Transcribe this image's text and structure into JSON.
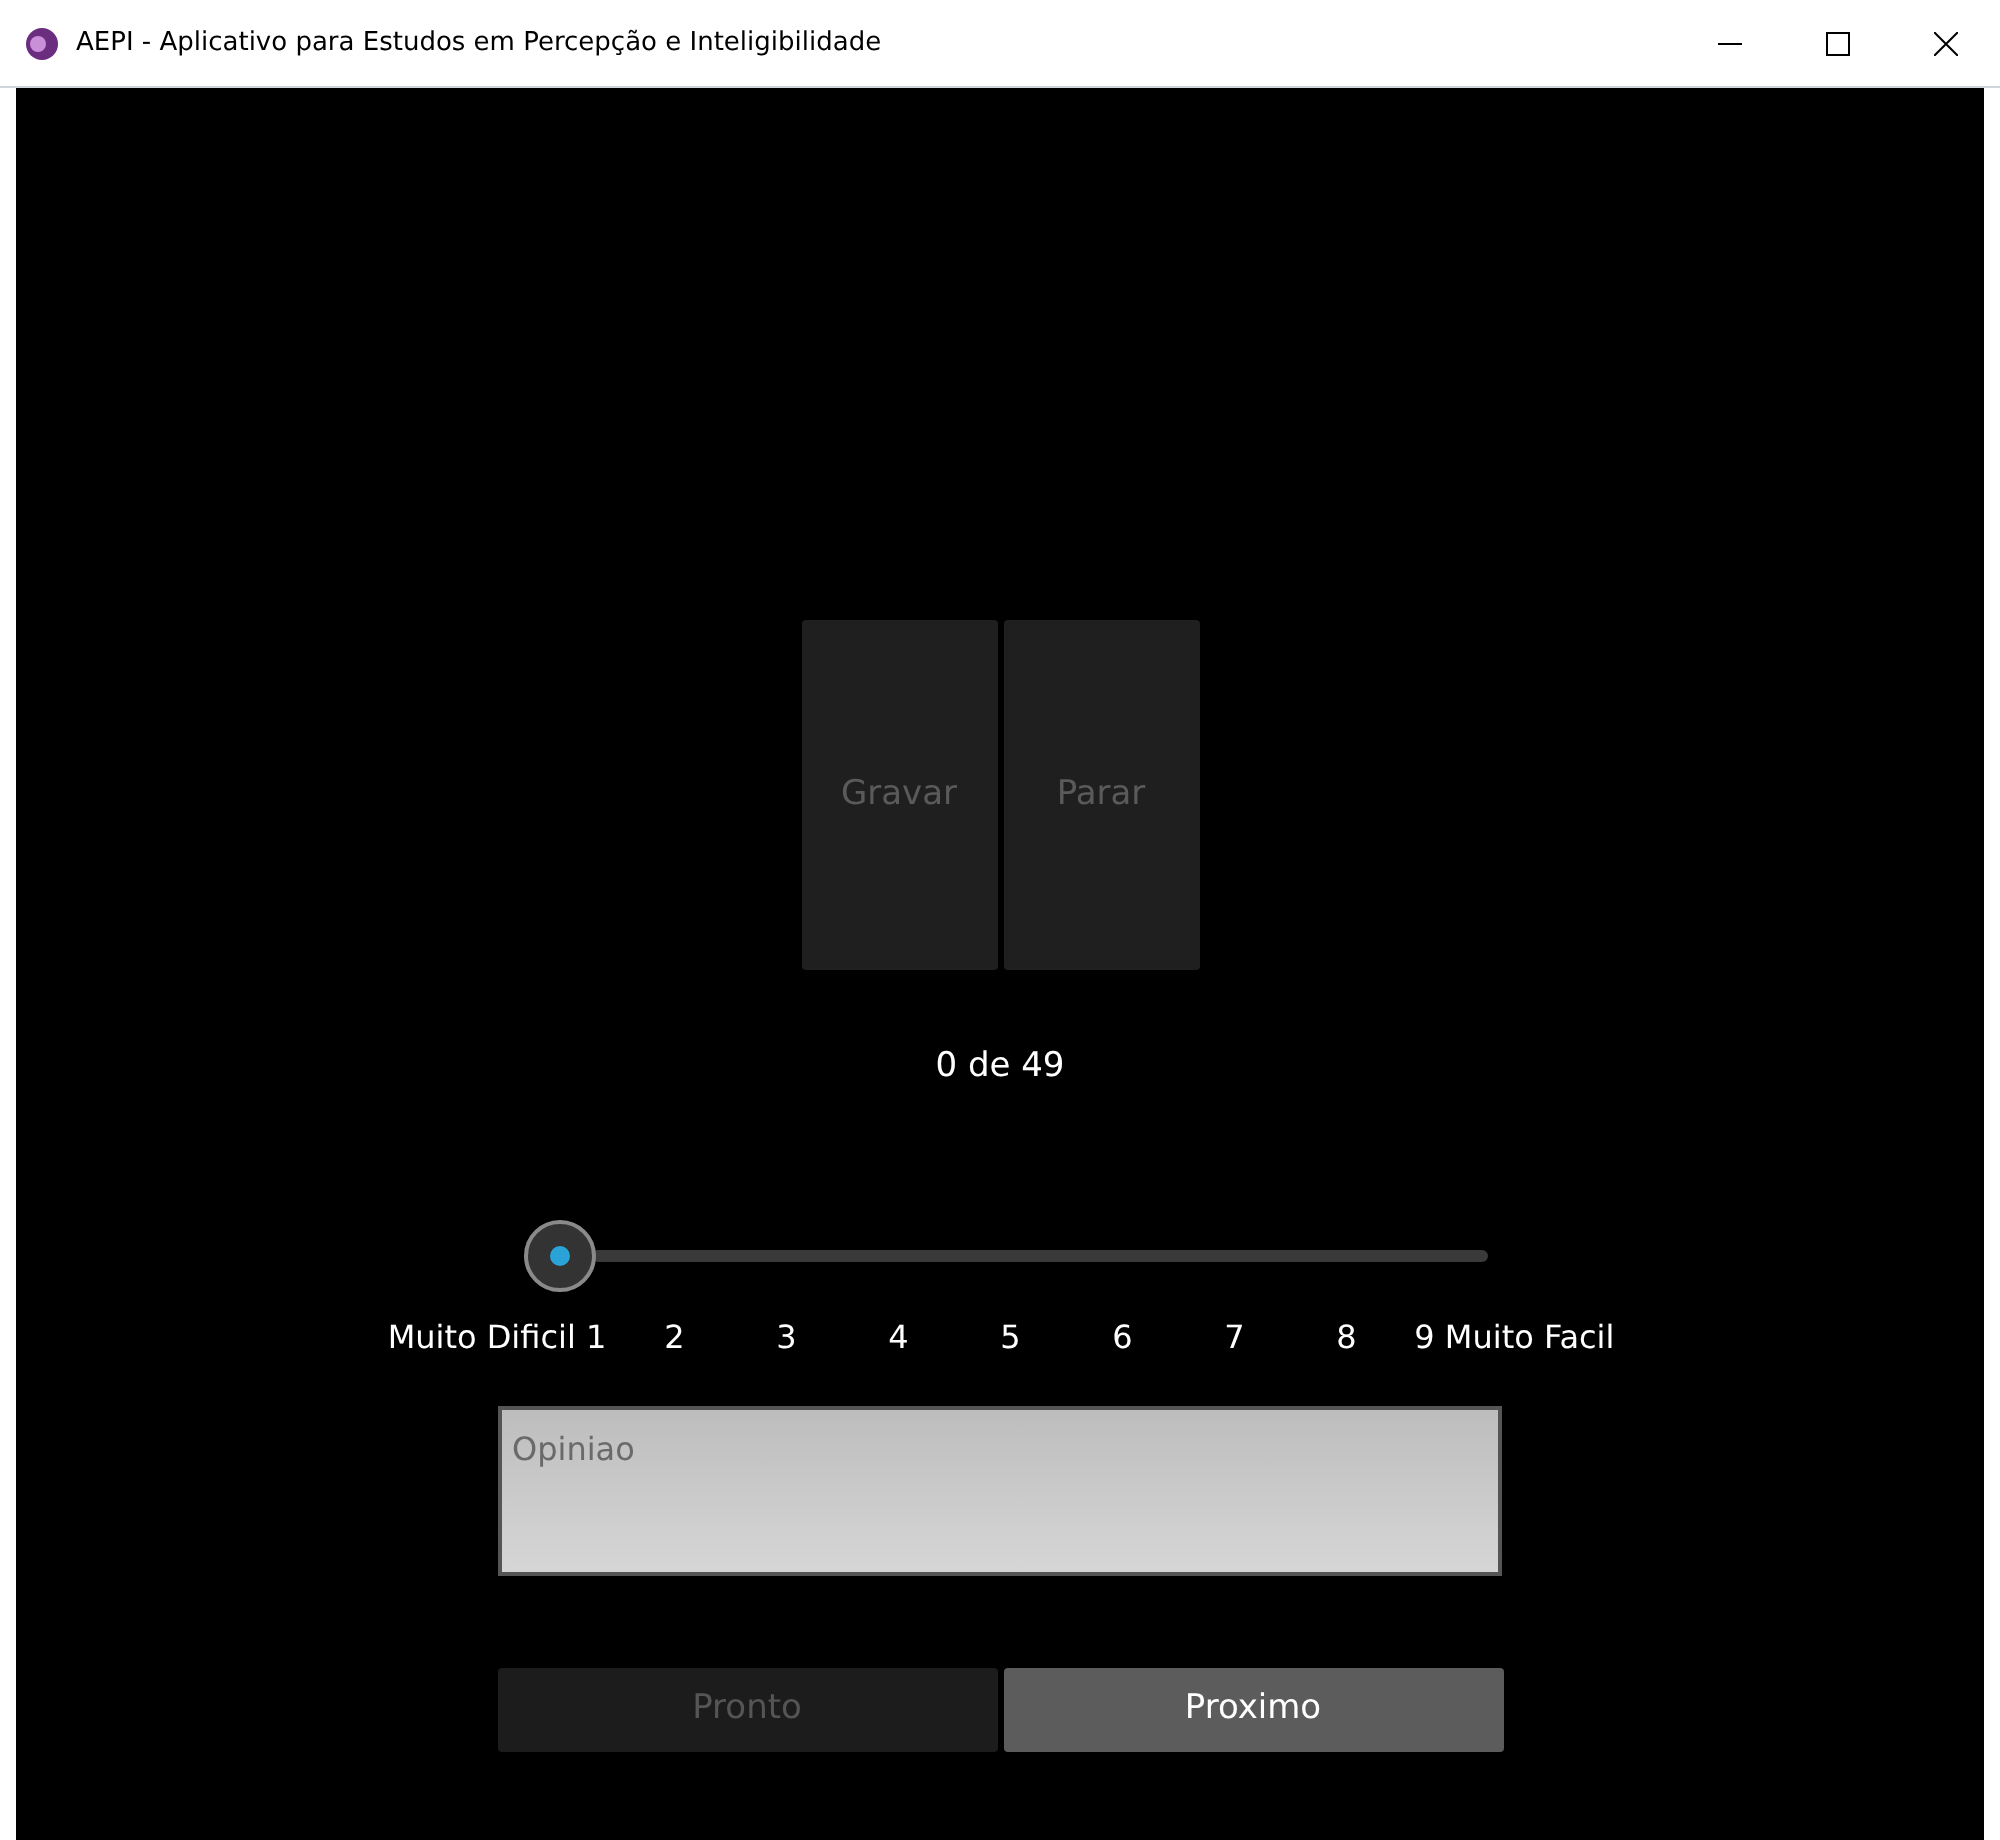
{
  "window": {
    "title": "AEPI - Aplicativo para Estudos em Percepção e Inteligibilidade"
  },
  "record_buttons": [
    {
      "label": "Gravar",
      "disabled": true
    },
    {
      "label": "Parar",
      "disabled": true
    }
  ],
  "counter": "0 de 49",
  "scale_labels": [
    "Muito Dificil 1",
    "2",
    "3",
    "4",
    "5",
    "6",
    "7",
    "8",
    "9 Muito Facil"
  ],
  "opinion": {
    "placeholder": "Opiniao"
  },
  "action_buttons": [
    {
      "label": "Pronto",
      "disabled": true
    },
    {
      "label": "Proximo",
      "disabled": false
    }
  ]
}
